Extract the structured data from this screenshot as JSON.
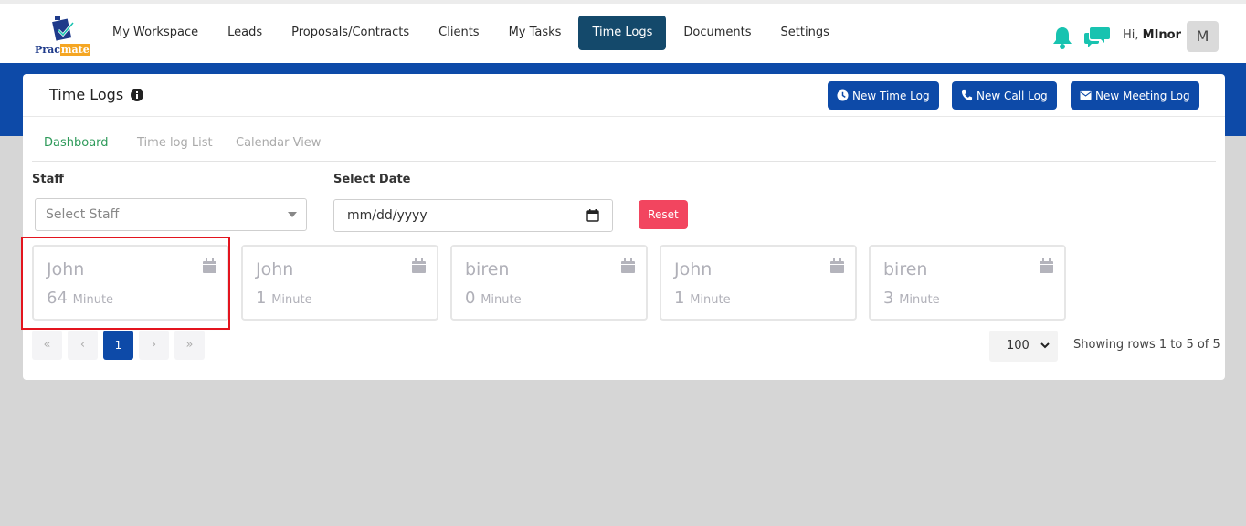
{
  "brand": {
    "name_part1": "Prac",
    "name_part2": "mate"
  },
  "nav": {
    "items": [
      {
        "label": "My Workspace",
        "active": false
      },
      {
        "label": "Leads",
        "active": false
      },
      {
        "label": "Proposals/Contracts",
        "active": false
      },
      {
        "label": "Clients",
        "active": false
      },
      {
        "label": "My Tasks",
        "active": false
      },
      {
        "label": "Time Logs",
        "active": true
      },
      {
        "label": "Documents",
        "active": false
      },
      {
        "label": "Settings",
        "active": false
      }
    ],
    "greeting_prefix": "Hi, ",
    "user_name": "MInor",
    "avatar_initial": "M"
  },
  "page": {
    "title": "Time Logs",
    "buttons": {
      "new_time_log": "New Time Log",
      "new_call_log": "New Call Log",
      "new_meeting_log": "New Meeting Log"
    },
    "tabs": [
      {
        "label": "Dashboard",
        "active": true
      },
      {
        "label": "Time log List",
        "active": false
      },
      {
        "label": "Calendar View",
        "active": false
      }
    ]
  },
  "filters": {
    "staff_label": "Staff",
    "staff_placeholder": "Select Staff",
    "date_label": "Select Date",
    "date_placeholder": "mm/dd/yyyy",
    "reset_label": "Reset"
  },
  "tiles": [
    {
      "name": "John",
      "value": "64",
      "unit": "Minute",
      "highlighted": true
    },
    {
      "name": "John",
      "value": "1",
      "unit": "Minute",
      "highlighted": false
    },
    {
      "name": "biren",
      "value": "0",
      "unit": "Minute",
      "highlighted": false
    },
    {
      "name": "John",
      "value": "1",
      "unit": "Minute",
      "highlighted": false
    },
    {
      "name": "biren",
      "value": "3",
      "unit": "Minute",
      "highlighted": false
    }
  ],
  "pagination": {
    "first": "«",
    "prev": "‹",
    "current": "1",
    "next": "›",
    "last": "»",
    "rows_per_page": "100",
    "showing_text": "Showing rows 1 to  5 of 5"
  },
  "colors": {
    "primary": "#0d4aa8",
    "nav_active": "#14496b",
    "accent_teal": "#18c3b0",
    "reset": "#f2455f",
    "tab_active": "#2e9a5a",
    "highlight_border": "#e3141e"
  },
  "icons": {
    "notification": "bell-icon",
    "messages": "chat-icon",
    "info": "info-icon",
    "clock": "clock-icon",
    "phone": "phone-icon",
    "envelope": "envelope-icon",
    "calendar": "calendar-icon"
  }
}
